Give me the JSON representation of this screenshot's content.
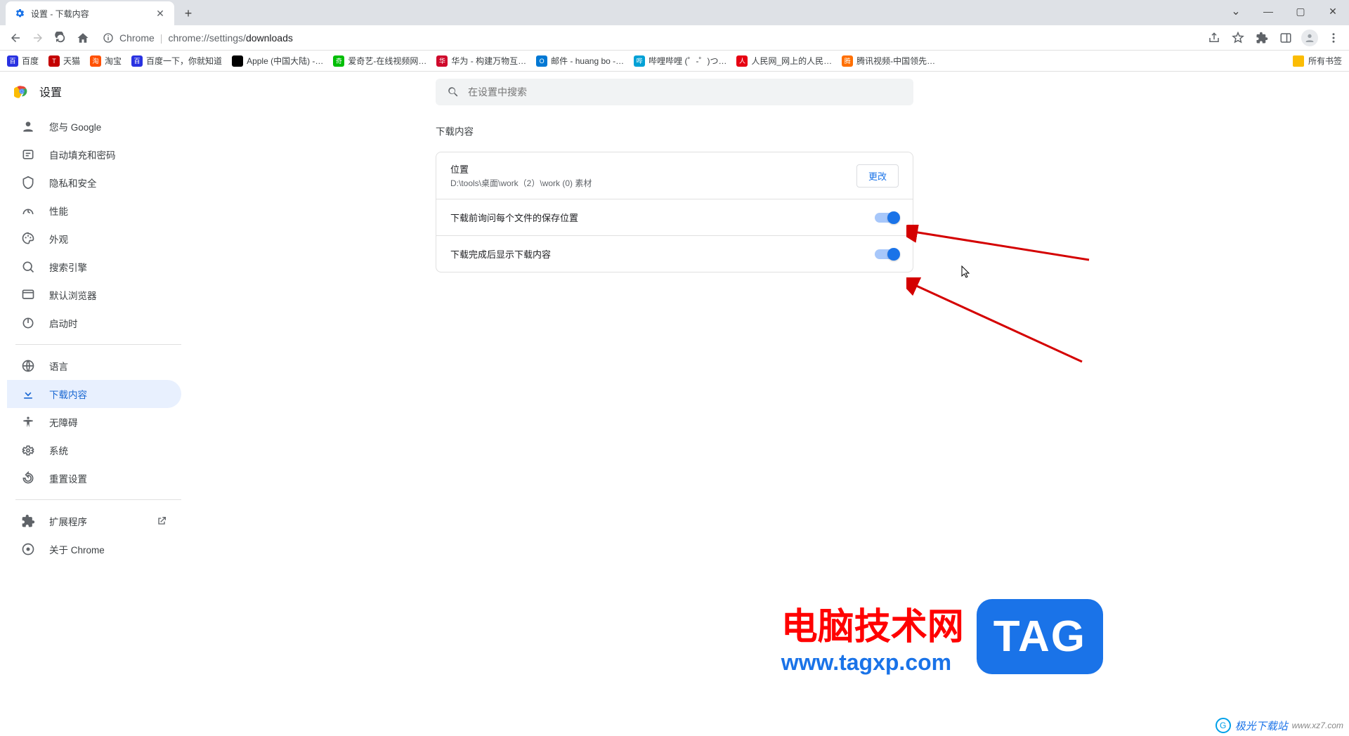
{
  "window": {
    "tab_title": "设置 - 下载内容"
  },
  "address": {
    "scheme_label": "Chrome",
    "host": "chrome://settings/",
    "path": "downloads"
  },
  "bookmarks": [
    {
      "label": "百度",
      "color": "#2932e1"
    },
    {
      "label": "天猫",
      "color": "#c40000"
    },
    {
      "label": "淘宝",
      "color": "#ff5000"
    },
    {
      "label": "百度一下，你就知道",
      "color": "#2932e1"
    },
    {
      "label": "Apple (中国大陆) -…",
      "color": "#000000"
    },
    {
      "label": "爱奇艺-在线视频网…",
      "color": "#00be06"
    },
    {
      "label": "华为 - 构建万物互…",
      "color": "#cf0a2c"
    },
    {
      "label": "邮件 - huang bo -…",
      "color": "#0078d4"
    },
    {
      "label": "哔哩哔哩 (゜-゜)つ…",
      "color": "#00a1d6"
    },
    {
      "label": "人民网_网上的人民…",
      "color": "#e60012"
    },
    {
      "label": "腾讯视频-中国领先…",
      "color": "#ff6f00"
    }
  ],
  "all_bookmarks": "所有书签",
  "settings": {
    "title": "设置",
    "search_placeholder": "在设置中搜索",
    "nav": [
      {
        "id": "you",
        "label": "您与 Google"
      },
      {
        "id": "autofill",
        "label": "自动填充和密码"
      },
      {
        "id": "privacy",
        "label": "隐私和安全"
      },
      {
        "id": "performance",
        "label": "性能"
      },
      {
        "id": "appearance",
        "label": "外观"
      },
      {
        "id": "search",
        "label": "搜索引擎"
      },
      {
        "id": "defaultBrowser",
        "label": "默认浏览器"
      },
      {
        "id": "onStartup",
        "label": "启动时"
      }
    ],
    "nav2": [
      {
        "id": "languages",
        "label": "语言"
      },
      {
        "id": "downloads",
        "label": "下载内容",
        "active": true
      },
      {
        "id": "accessibility",
        "label": "无障碍"
      },
      {
        "id": "system",
        "label": "系统"
      },
      {
        "id": "reset",
        "label": "重置设置"
      }
    ],
    "nav3": [
      {
        "id": "extensions",
        "label": "扩展程序",
        "external": true
      },
      {
        "id": "about",
        "label": "关于 Chrome"
      }
    ]
  },
  "main": {
    "section_title": "下载内容",
    "location_label": "位置",
    "location_value": "D:\\tools\\桌面\\work（2）\\work (0) 素材",
    "change_btn": "更改",
    "toggle1": "下载前询问每个文件的保存位置",
    "toggle2": "下载完成后显示下载内容"
  },
  "watermark": {
    "line1": "电脑技术网",
    "line2": "www.tagxp.com",
    "tag": "TAG",
    "footer_brand": "极光下载站",
    "footer_url": "www.xz7.com"
  }
}
